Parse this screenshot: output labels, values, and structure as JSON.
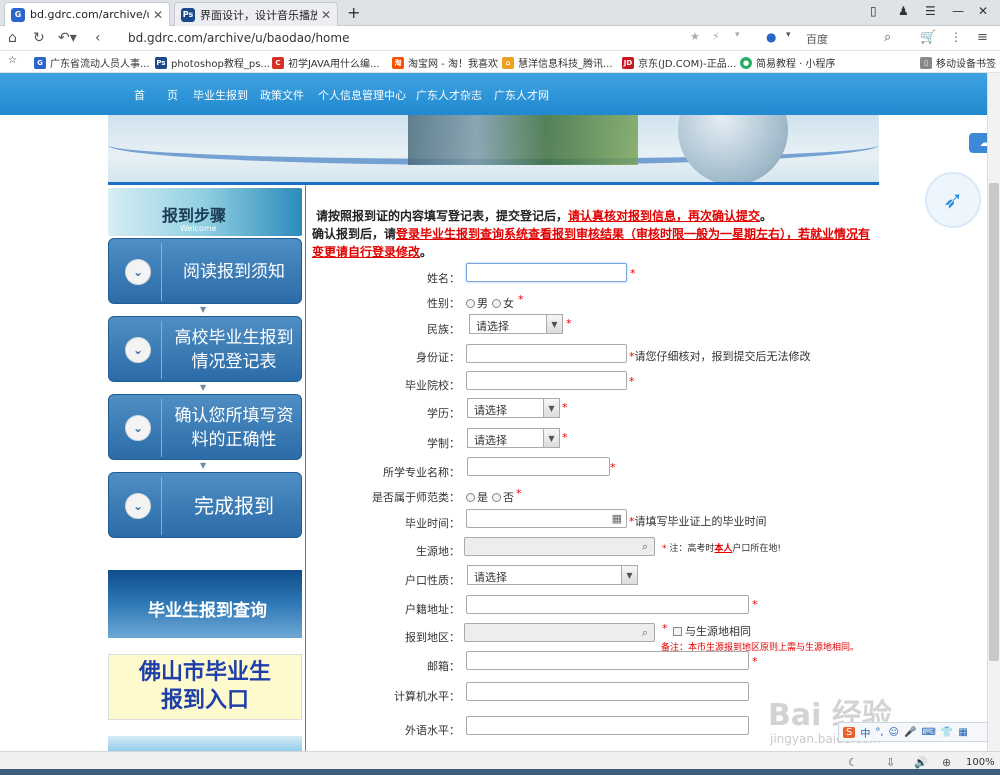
{
  "browser": {
    "tabs": [
      {
        "title": "bd.gdrc.com/archive/u/bao",
        "active": true
      },
      {
        "title": "界面设计，设计音乐播放器界",
        "active": false
      }
    ],
    "new_tab": "+",
    "url": "bd.gdrc.com/archive/u/baodao/home",
    "search_engine": "百度",
    "bookmarks": [
      "广东省流动人员人事...",
      "photoshop教程_ps...",
      "初学JAVA用什么编...",
      "淘宝网 - 淘！我喜欢",
      "慧洋信息科技_腾讯...",
      "京东(JD.COM)-正品...",
      "简易教程 · 小程序",
      "移动设备书签"
    ],
    "zoom": "100%"
  },
  "nav": {
    "items": [
      "首　　页",
      "毕业生报到",
      "政策文件",
      "个人信息管理中心",
      "广东人才杂志",
      "广东人才网"
    ]
  },
  "sidebar": {
    "header_title": "报到步骤",
    "header_sub": "Welcome",
    "steps": [
      {
        "label": "阅读报到须知"
      },
      {
        "label": "高校毕业生报到情况登记表"
      },
      {
        "label": "确认您所填写资料的正确性"
      },
      {
        "label": "完成报到"
      }
    ],
    "query_banner": "毕业生报到查询",
    "foshan_line1": "佛山市毕业生",
    "foshan_line2": "报到入口"
  },
  "intro": {
    "p1": "请按照报到证的内容填写登记表，提交登记后，",
    "p1_red": "请认真核对报到信息，再次确认提交",
    "p1_end": "。",
    "p2": "确认报到后，请",
    "p2_red": "登录毕业生报到查询系统查看报到审核结果（审核时限一般为一星期左右），若就业情况有变更请自行登录修改",
    "p2_end": "。"
  },
  "form": {
    "name_label": "姓名：",
    "gender_label": "性别：",
    "gender_male": "男",
    "gender_female": "女",
    "ethnic_label": "民族：",
    "ethnic_value": "请选择",
    "id_label": "身份证：",
    "id_hint": "请您仔细核对，报到提交后无法修改",
    "school_label": "毕业院校：",
    "edu_label": "学历：",
    "edu_value": "请选择",
    "length_label": "学制：",
    "length_value": "请选择",
    "major_label": "所学专业名称：",
    "normal_label": "是否属于师范类：",
    "normal_yes": "是",
    "normal_no": "否",
    "gradtime_label": "毕业时间：",
    "gradtime_hint": "请填写毕业证上的毕业时间",
    "origin_label": "生源地：",
    "origin_hint_pre": "注：高考时",
    "origin_hint_mid": "本人",
    "origin_hint_post": "户口所在地!",
    "hukou_type_label": "户口性质：",
    "hukou_type_value": "请选择",
    "hukou_addr_label": "户籍地址：",
    "report_area_label": "报到地区：",
    "same_as_origin": "与生源地相同",
    "report_note": "备注：本市生源报到地区原则上需与生源地相同。",
    "email_label": "邮箱：",
    "computer_label": "计算机水平：",
    "language_label": "外语水平："
  },
  "watermark": {
    "main": "Bai 经验",
    "sub": "jingyan.baidu.com"
  },
  "ime": {
    "items": [
      "中",
      "°,",
      "☺",
      "🎤",
      "⌨",
      "👕",
      "▦"
    ]
  }
}
